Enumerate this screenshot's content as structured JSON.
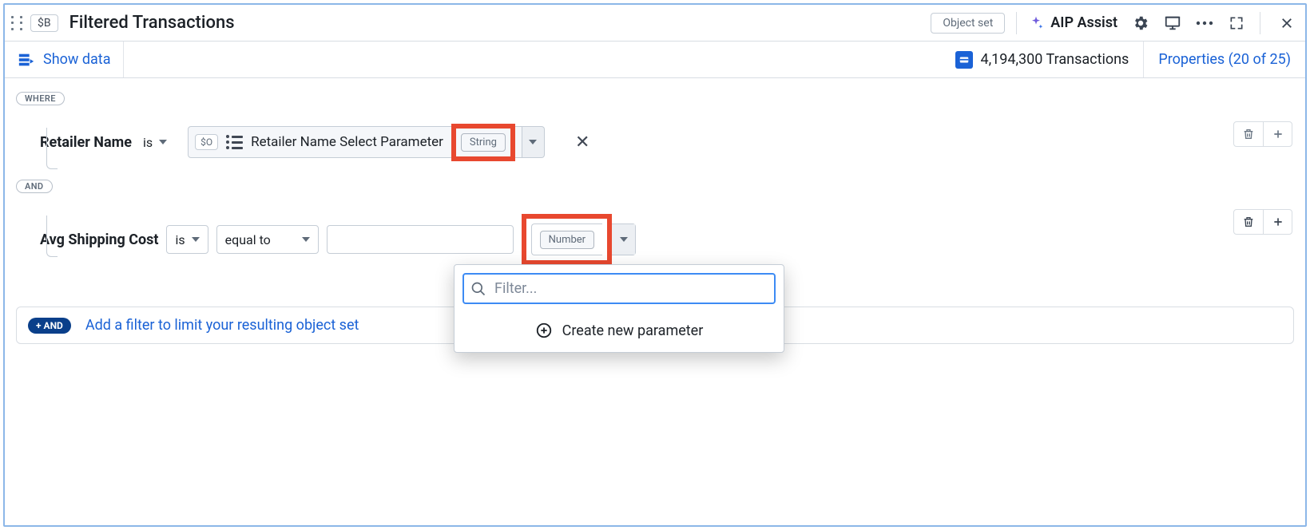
{
  "header": {
    "var_badge": "$B",
    "title": "Filtered Transactions",
    "object_set_label": "Object set",
    "aip_label": "AIP Assist"
  },
  "subheader": {
    "show_data_label": "Show data",
    "tx_count_label": "4,194,300 Transactions",
    "properties_label": "Properties (20 of 25)"
  },
  "clauses": {
    "where_label": "WHERE",
    "and_label": "AND"
  },
  "filters": {
    "retailer": {
      "field": "Retailer Name",
      "op": "is",
      "param_chip": "$O",
      "param_name": "Retailer Name Select Parameter",
      "type_tag": "String"
    },
    "shipping": {
      "field": "Avg Shipping Cost",
      "op": "is",
      "comparator": "equal to",
      "type_tag": "Number"
    }
  },
  "popover": {
    "filter_placeholder": "Filter...",
    "create_label": "Create new parameter"
  },
  "addbar": {
    "badge": "+ AND",
    "text": "Add a filter to limit your resulting object set"
  }
}
